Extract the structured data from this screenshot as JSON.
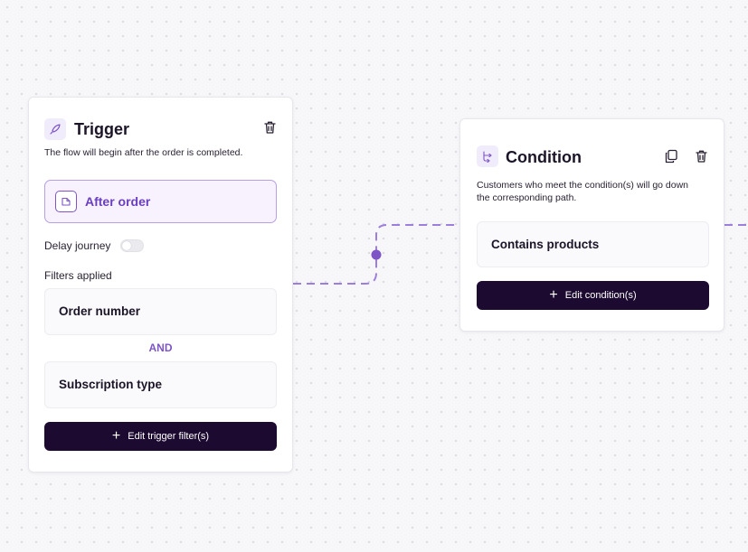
{
  "trigger": {
    "title": "Trigger",
    "description": "The flow will begin after the order is completed.",
    "event_label": "After order",
    "delay_label": "Delay journey",
    "filters_heading": "Filters applied",
    "filters": [
      "Order number",
      "Subscription type"
    ],
    "and_label": "AND",
    "edit_button_label": "Edit trigger filter(s)",
    "delay_enabled": false
  },
  "condition": {
    "title": "Condition",
    "description_line1": "Customers who meet the condition(s) will go down",
    "description_line2": "the corresponding path.",
    "rule": "Contains products",
    "edit_button_label": "Edit condition(s)"
  },
  "colors": {
    "accent": "#7d55c7",
    "accent_light": "#f7f2fd",
    "button_dark": "#1c0a30",
    "connector": "#9c7fdc"
  },
  "icons": {
    "trigger": "rocket-icon",
    "condition": "branch-icon",
    "event": "document-icon",
    "delete": "trash-icon",
    "duplicate": "copy-icon",
    "add": "plus-icon"
  }
}
